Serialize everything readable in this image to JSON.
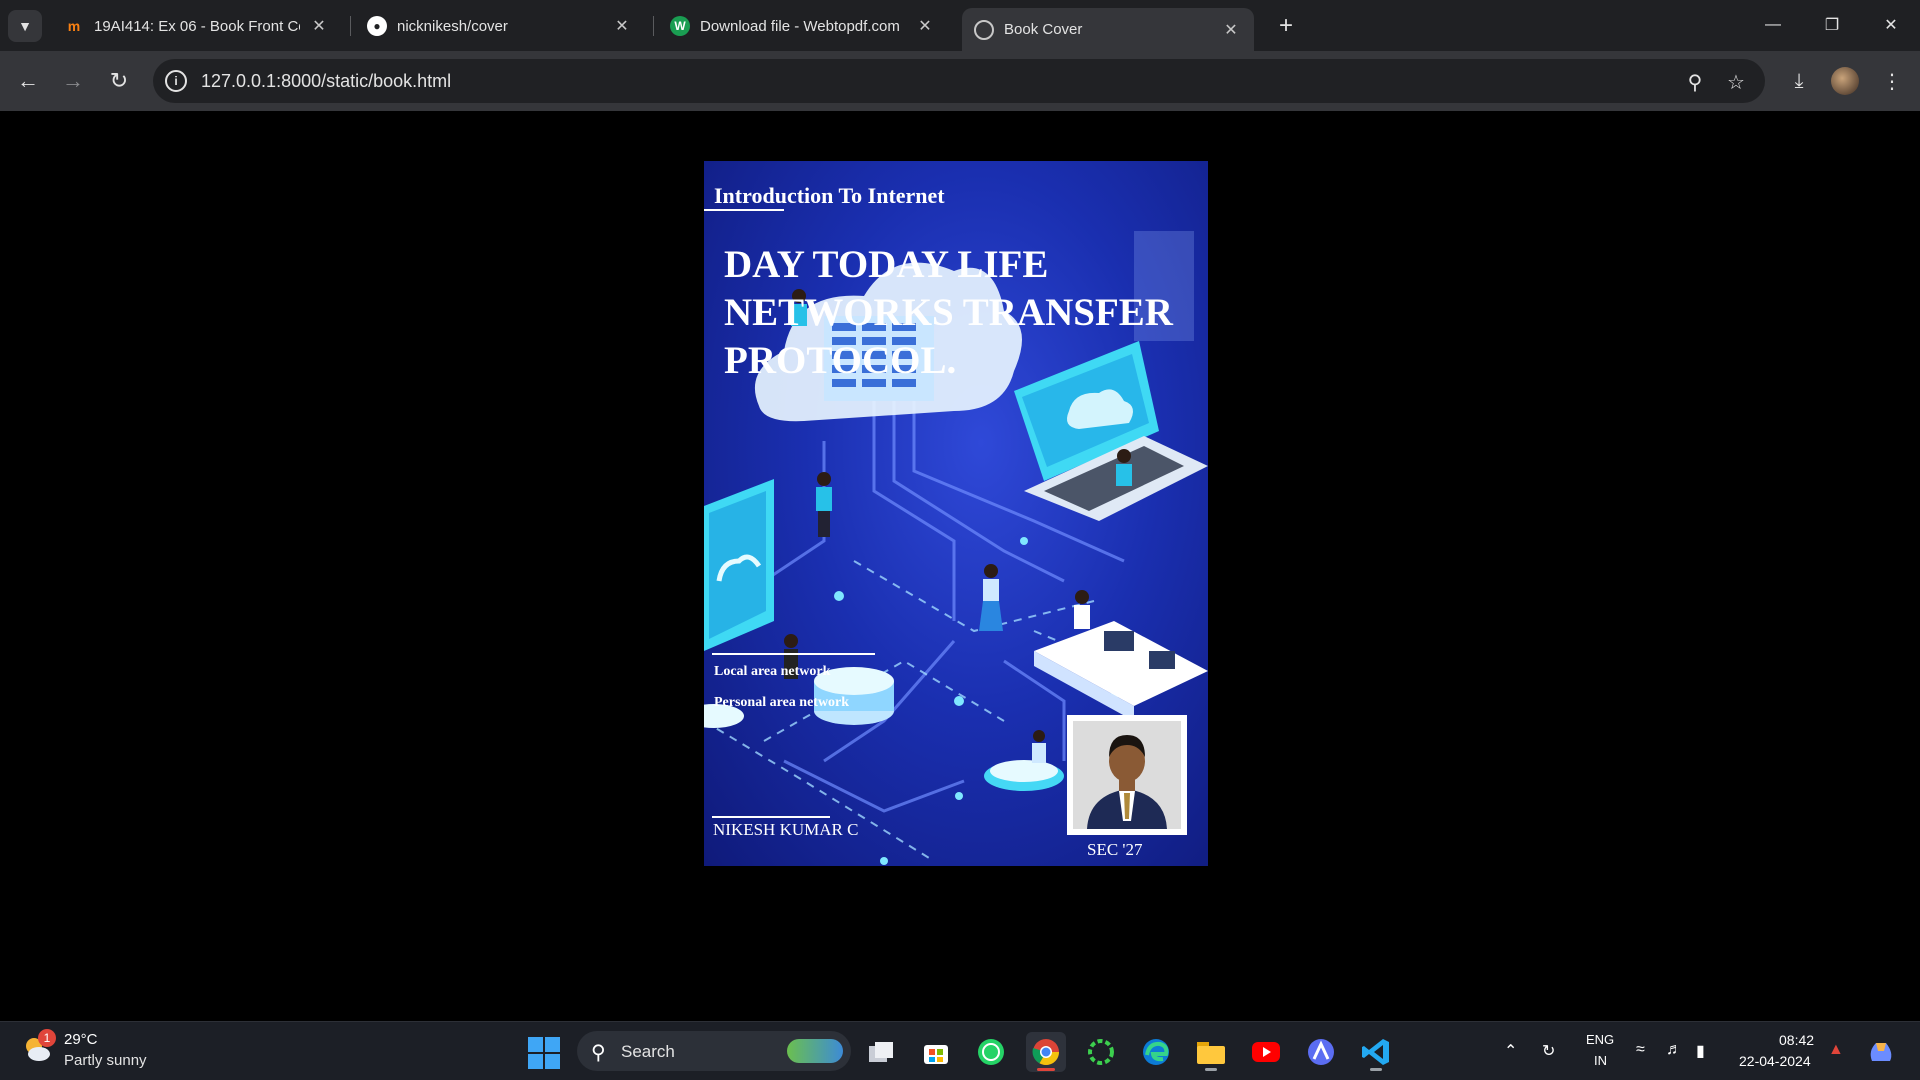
{
  "browser": {
    "tabs": [
      {
        "title": "19AI414: Ex 06 - Book Front Co",
        "favicon": "moodle-icon",
        "active": false
      },
      {
        "title": "nicknikesh/cover",
        "favicon": "github-icon",
        "active": false
      },
      {
        "title": "Download file - Webtopdf.com",
        "favicon": "webtopdf-icon",
        "active": false
      },
      {
        "title": "Book Cover",
        "favicon": "globe-icon",
        "active": true
      }
    ],
    "url": "127.0.0.1:8000/static/book.html"
  },
  "book": {
    "subject": "Introduction To Internet",
    "headline_lines": [
      "DAY TODAY LIFE",
      "NETWORKS TRANSFER",
      "PROTOCOL."
    ],
    "topics": [
      "Local area network",
      "Personal area network"
    ],
    "author": "NIKESH KUMAR C",
    "photo_caption": "SEC '27"
  },
  "taskbar": {
    "weather": {
      "temp": "29°C",
      "desc": "Partly sunny",
      "badge": "1"
    },
    "search_label": "Search",
    "language": [
      "ENG",
      "IN"
    ],
    "time": "08:42",
    "date": "22-04-2024"
  },
  "colors": {
    "cover_blue": "#1a2fb0",
    "accent_cyan": "#35d3f0",
    "chrome_dark": "#35363a"
  }
}
